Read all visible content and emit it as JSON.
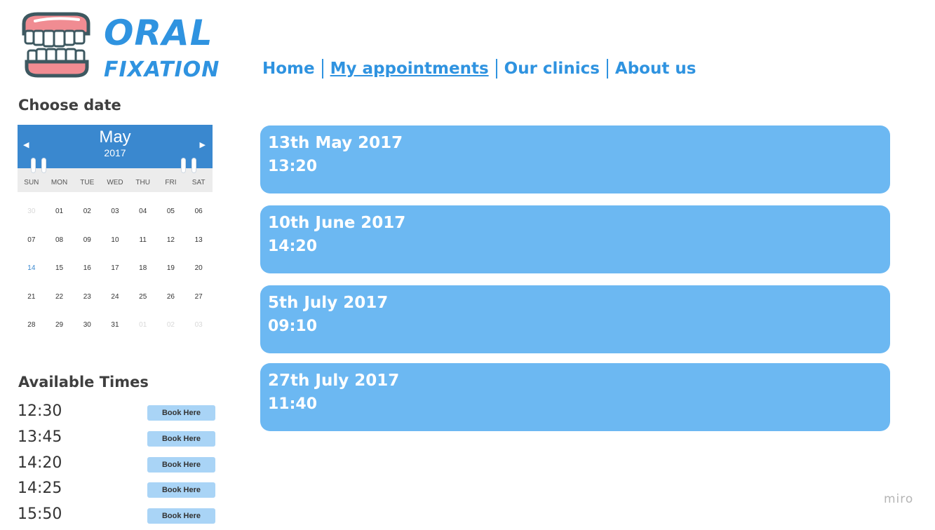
{
  "brand": {
    "line1": "ORAL",
    "line2": "FIXATION",
    "accent": "#2f93e0"
  },
  "nav": [
    {
      "label": "Home"
    },
    {
      "label": "My appointments",
      "active": true
    },
    {
      "label": "Our clinics"
    },
    {
      "label": "About us"
    }
  ],
  "choose_date": {
    "title": "Choose date",
    "calendar": {
      "month": "May",
      "year": "2017",
      "prev_icon": "chevron-left-icon",
      "next_icon": "chevron-right-icon",
      "weekdays": [
        "SUN",
        "MON",
        "TUE",
        "WED",
        "THU",
        "FRI",
        "SAT"
      ],
      "days": [
        {
          "label": "30",
          "muted": true
        },
        {
          "label": "01"
        },
        {
          "label": "02"
        },
        {
          "label": "03"
        },
        {
          "label": "04"
        },
        {
          "label": "05"
        },
        {
          "label": "06"
        },
        {
          "label": "07"
        },
        {
          "label": "08"
        },
        {
          "label": "09"
        },
        {
          "label": "10"
        },
        {
          "label": "11"
        },
        {
          "label": "12"
        },
        {
          "label": "13"
        },
        {
          "label": "14",
          "today": true
        },
        {
          "label": "15"
        },
        {
          "label": "16"
        },
        {
          "label": "17"
        },
        {
          "label": "18"
        },
        {
          "label": "19"
        },
        {
          "label": "20"
        },
        {
          "label": "21"
        },
        {
          "label": "22"
        },
        {
          "label": "23"
        },
        {
          "label": "24"
        },
        {
          "label": "25"
        },
        {
          "label": "26"
        },
        {
          "label": "27"
        },
        {
          "label": "28"
        },
        {
          "label": "29"
        },
        {
          "label": "30"
        },
        {
          "label": "31"
        },
        {
          "label": "01",
          "muted": true
        },
        {
          "label": "02",
          "muted": true
        },
        {
          "label": "03",
          "muted": true
        }
      ]
    }
  },
  "available_times": {
    "title": "Available Times",
    "button_label": "Book Here",
    "times": [
      "12:30",
      "13:45",
      "14:20",
      "14:25",
      "15:50"
    ]
  },
  "appointments": [
    {
      "date": "13th May 2017",
      "time": "13:20"
    },
    {
      "date": "10th June 2017",
      "time": "14:20"
    },
    {
      "date": "5th July 2017",
      "time": "09:10"
    },
    {
      "date": "27th July 2017",
      "time": "11:40"
    }
  ],
  "watermark": "miro",
  "colors": {
    "card": "#6cb8f2",
    "calendar_header": "#3a88cf",
    "book_button": "#a9d4f6"
  }
}
